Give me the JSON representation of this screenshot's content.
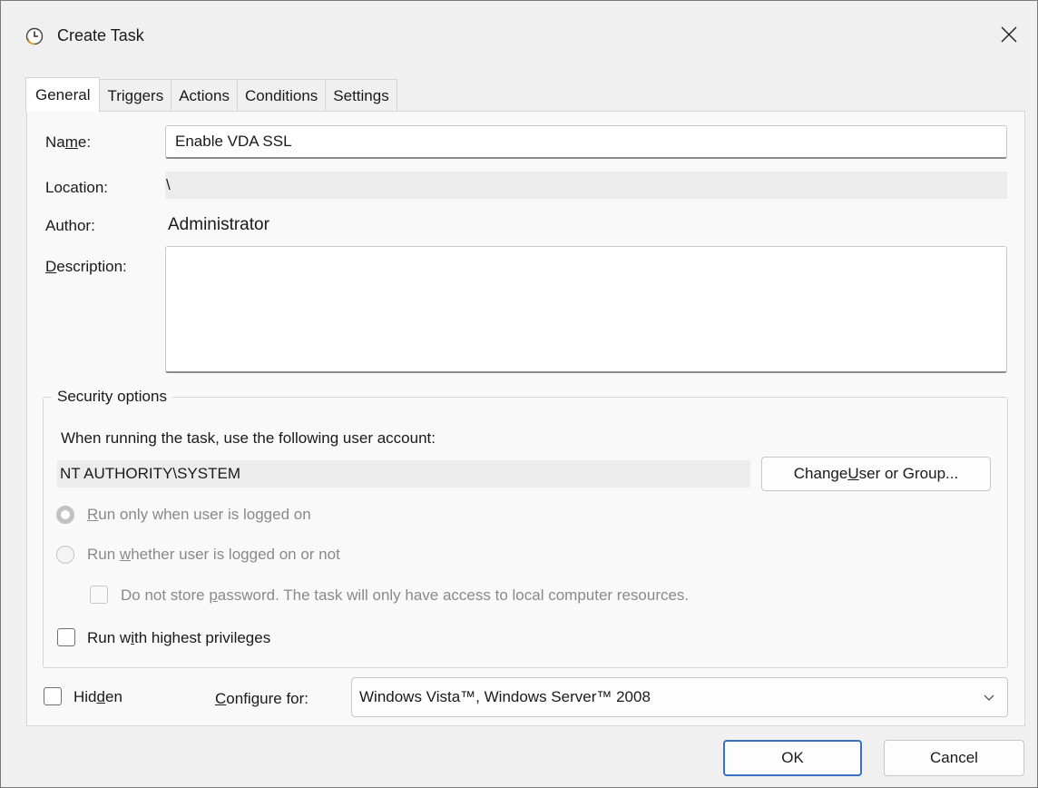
{
  "window": {
    "title": "Create Task"
  },
  "tabs": [
    {
      "label": "General",
      "active": true
    },
    {
      "label": "Triggers",
      "active": false
    },
    {
      "label": "Actions",
      "active": false
    },
    {
      "label": "Conditions",
      "active": false
    },
    {
      "label": "Settings",
      "active": false
    }
  ],
  "general": {
    "name_label_pre": "Na",
    "name_label_u": "m",
    "name_label_post": "e:",
    "name_value": "Enable VDA SSL",
    "location_label": "Location:",
    "location_value": "\\",
    "author_label": "Author:",
    "author_value": "Administrator",
    "description_label_u": "D",
    "description_label_post": "escription:",
    "description_value": ""
  },
  "security": {
    "legend": "Security options",
    "account_prompt": "When running the task, use the following user account:",
    "account_value": "NT AUTHORITY\\SYSTEM",
    "change_user_pre": "Change ",
    "change_user_u": "U",
    "change_user_post": "ser or Group...",
    "run_logged_on_u": "R",
    "run_logged_on_post": "un only when user is logged on",
    "run_logged_on_checked": true,
    "run_whether_pre": "Run ",
    "run_whether_u": "w",
    "run_whether_post": "hether user is logged on or not",
    "run_whether_checked": false,
    "no_store_pre": "Do not store ",
    "no_store_u": "p",
    "no_store_post": "assword.  The task will only have access to local computer resources.",
    "highest_pre": "Run w",
    "highest_u": "i",
    "highest_post": "th highest privileges"
  },
  "footer": {
    "hidden_pre": "Hid",
    "hidden_u": "d",
    "hidden_post": "en",
    "configure_u": "C",
    "configure_post": "onfigure for:",
    "configure_value": "Windows Vista™, Windows Server™ 2008",
    "ok_label": "OK",
    "cancel_label": "Cancel"
  }
}
